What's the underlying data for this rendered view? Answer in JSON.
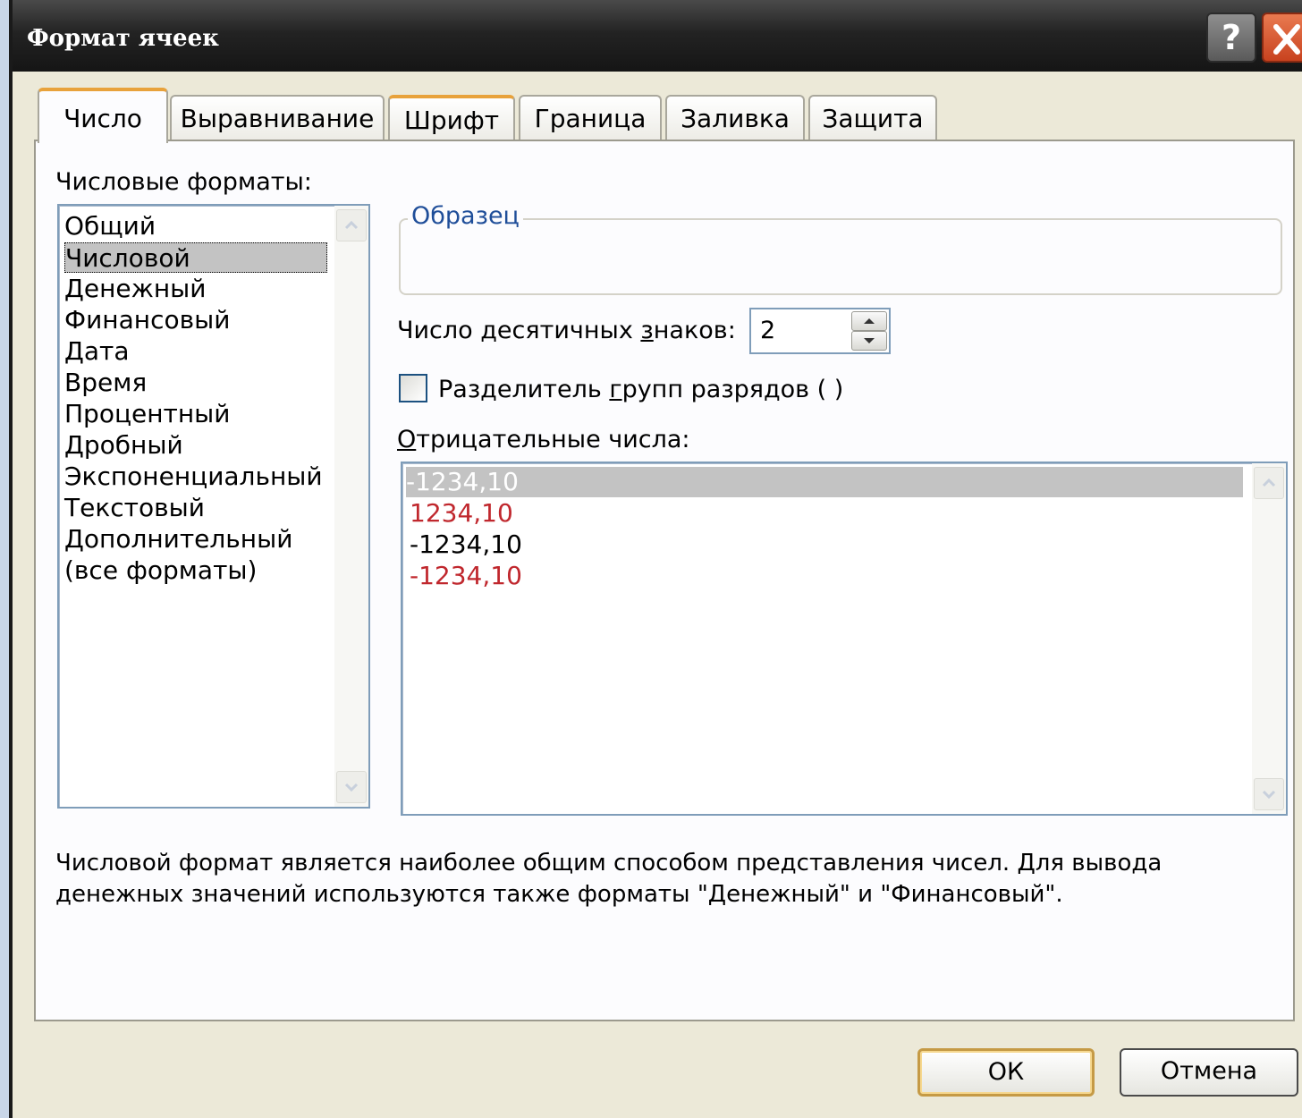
{
  "dialog": {
    "title": "Формат ячеек",
    "help_label": "?"
  },
  "tabs": [
    {
      "label": "Число",
      "active": true
    },
    {
      "label": "Выравнивание"
    },
    {
      "label": "Шрифт"
    },
    {
      "label": "Граница"
    },
    {
      "label": "Заливка"
    },
    {
      "label": "Защита"
    }
  ],
  "number_formats": {
    "label": "Числовые форматы:",
    "items": [
      "Общий",
      "Числовой",
      "Денежный",
      "Финансовый",
      "Дата",
      "Время",
      "Процентный",
      "Дробный",
      "Экспоненциальный",
      "Текстовый",
      "Дополнительный",
      "(все форматы)"
    ],
    "selected": "Числовой"
  },
  "sample": {
    "title": "Образец"
  },
  "decimals": {
    "label": "Число десятичных знаков:",
    "value": "2"
  },
  "separator": {
    "label": "Разделитель групп разрядов ( )",
    "checked": false
  },
  "negative": {
    "label": "Отрицательные числа:",
    "items": [
      {
        "text": "-1234,10",
        "color": "#ffffff",
        "selected": true
      },
      {
        "text": "1234,10",
        "color": "#c0272d"
      },
      {
        "text": "-1234,10",
        "color": "#000000"
      },
      {
        "text": "-1234,10",
        "color": "#c0272d"
      }
    ]
  },
  "description": "Числовой формат является наиболее общим способом представления чисел. Для вывода денежных значений используются также форматы \"Денежный\" и \"Финансовый\".",
  "buttons": {
    "ok": "ОК",
    "cancel": "Отмена"
  },
  "colors": {
    "accent_tab": "#e8a23b",
    "group_title": "#1f4e99",
    "negative_red": "#c0272d"
  }
}
